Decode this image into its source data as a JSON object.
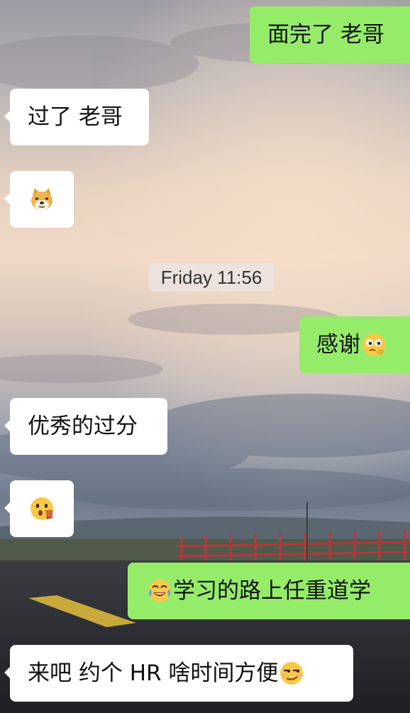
{
  "messages": [
    {
      "side": "out",
      "text": "面完了 老哥"
    },
    {
      "side": "in",
      "text": "过了 老哥"
    },
    {
      "side": "in",
      "emoji": "doge-face-icon"
    },
    {
      "side": "in",
      "text": "优秀的过分"
    },
    {
      "side": "in",
      "emoji": "surprised-face-with-hand-icon"
    },
    {
      "side": "out",
      "text": "感谢",
      "emoji_after": "thinking-face-icon"
    },
    {
      "side": "out",
      "text": "学习的路上任重道学",
      "emoji_before": "laugh-cry-face-icon"
    },
    {
      "side": "in",
      "text": "来吧 约个 HR  啥时间方便",
      "emoji_after": "smirk-face-icon"
    }
  ],
  "timestamp": "Friday 11:56",
  "colors": {
    "outgoing_bubble": "#95ec69",
    "incoming_bubble": "#ffffff",
    "timestamp_bg": "#ebe6e4"
  },
  "background": "sunset-sky-and-road-wallpaper"
}
